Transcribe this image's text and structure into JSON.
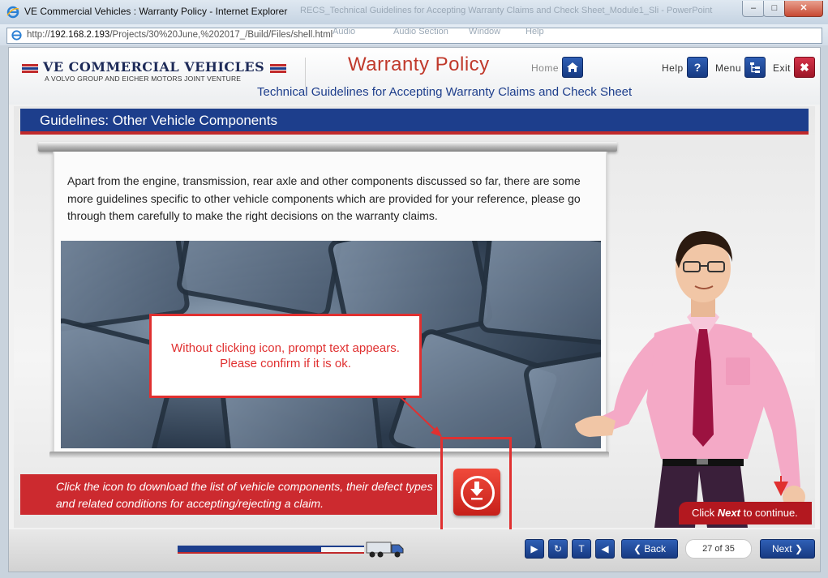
{
  "window": {
    "title": "VE Commercial Vehicles : Warranty Policy - Internet Explorer",
    "background_tab_title": "RECS_Technical Guidelines for Accepting Warranty Claims and Check Sheet_Module1_Sli - PowerPoint",
    "minimize_glyph": "–",
    "maximize_glyph": "□",
    "close_glyph": "✕"
  },
  "address_bar": {
    "url_host": "192.168.2.193",
    "url_prefix": "http://",
    "url_path": "/Projects/30%20June,%202017_/Build/Files/shell.html",
    "ghost_items": [
      "Audio",
      "Audio Section",
      "Window",
      "Help"
    ]
  },
  "header": {
    "brand": "VE COMMERCIAL VEHICLES",
    "brand_sub": "A VOLVO GROUP AND EICHER MOTORS JOINT VENTURE",
    "title": "Warranty Policy",
    "course_title": "Technical Guidelines for Accepting Warranty Claims and Check Sheet",
    "home_label": "Home",
    "help_label": "Help",
    "help_glyph": "?",
    "menu_label": "Menu",
    "exit_label": "Exit",
    "exit_glyph": "✖"
  },
  "slide": {
    "section_title": "Guidelines: Other Vehicle Components",
    "intro_text": "Apart from the engine, transmission, rear axle and other components discussed so far, there are some more guidelines specific to other vehicle components which are provided for your reference, please go through them carefully to make the right decisions on the warranty claims.",
    "review_prompt": "Without clicking icon, prompt text appears. Please confirm if it is ok.",
    "instruction": "Click the icon to download the list of vehicle components, their defect types and related conditions for accepting/rejecting a claim.",
    "callout_prefix": "Click ",
    "callout_bold": "Next",
    "callout_suffix": " to continue."
  },
  "footer": {
    "progress_fraction": 0.77,
    "back_label": "Back",
    "back_glyph": "❮",
    "next_label": "Next",
    "next_glyph": "❯",
    "page_indicator": "27 of 35",
    "play_glyph": "▶",
    "replay_glyph": "↻",
    "transcript_glyph": "T",
    "audio_glyph": "◀"
  },
  "colors": {
    "brand_blue": "#1d3e8c",
    "brand_red": "#c0292b",
    "prompt_red": "#e03030"
  }
}
